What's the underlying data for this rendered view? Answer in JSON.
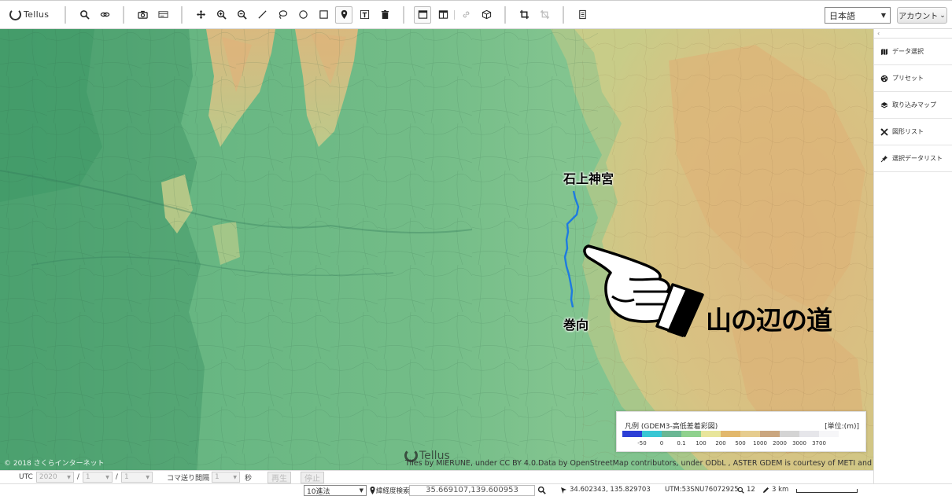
{
  "app": {
    "logo_text": "Tellus"
  },
  "toolbar": {
    "language": "日本語",
    "account_label": "アカウント",
    "account_caret": "⌄"
  },
  "map": {
    "labels": {
      "isonokami": "石上神宮",
      "makimuku": "巻向",
      "title": "山の辺の道"
    },
    "route_color": "#1e7be0",
    "copyright": "© 2018 さくらインターネット",
    "attribution": "Tiles by MIERUNE, under CC BY 4.0.Data by OpenStreetMap contributors, under ODbL , ASTER GDEM is courtesy of METI and NASA",
    "watermark": "Tellus"
  },
  "legend": {
    "title": "凡例 (GDEM3-高低差着彩図)",
    "unit": "[単位:(m)]",
    "colors": [
      "#2c3fd6",
      "#38c7d4",
      "#6ab794",
      "#8fd18d",
      "#e8e59a",
      "#e2b86c",
      "#e6cc8e",
      "#caa67f",
      "#d4d4d4",
      "#e6e6ea",
      "#f6f6f8"
    ],
    "ticks": [
      "-50",
      "0",
      "0.1",
      "100",
      "200",
      "500",
      "1000",
      "2000",
      "3000",
      "3700"
    ]
  },
  "sidebar": {
    "collapse": "‹",
    "items": [
      {
        "label": "データ選択",
        "icon": "map-book-icon"
      },
      {
        "label": "プリセット",
        "icon": "palette-icon"
      },
      {
        "label": "取り込みマップ",
        "icon": "layers-icon"
      },
      {
        "label": "図形リスト",
        "icon": "shapes-tools-icon"
      },
      {
        "label": "選択データリスト",
        "icon": "pin-list-icon"
      }
    ]
  },
  "timebar": {
    "utc_label": "UTC",
    "year": "2020",
    "month": "1",
    "day": "1",
    "sep": "/",
    "interval_label": "コマ送り間隔",
    "interval_value": "1",
    "interval_unit": "秒",
    "play": "再生",
    "stop": "停止"
  },
  "status": {
    "format": "10進法",
    "search_label": "緯経度検索",
    "search_value": "35.669107,139.600953",
    "cursor_coords": "34.602343, 135.829703",
    "utm": "UTM:53SNU76072925",
    "zoom": "12",
    "scale": "3 km"
  }
}
